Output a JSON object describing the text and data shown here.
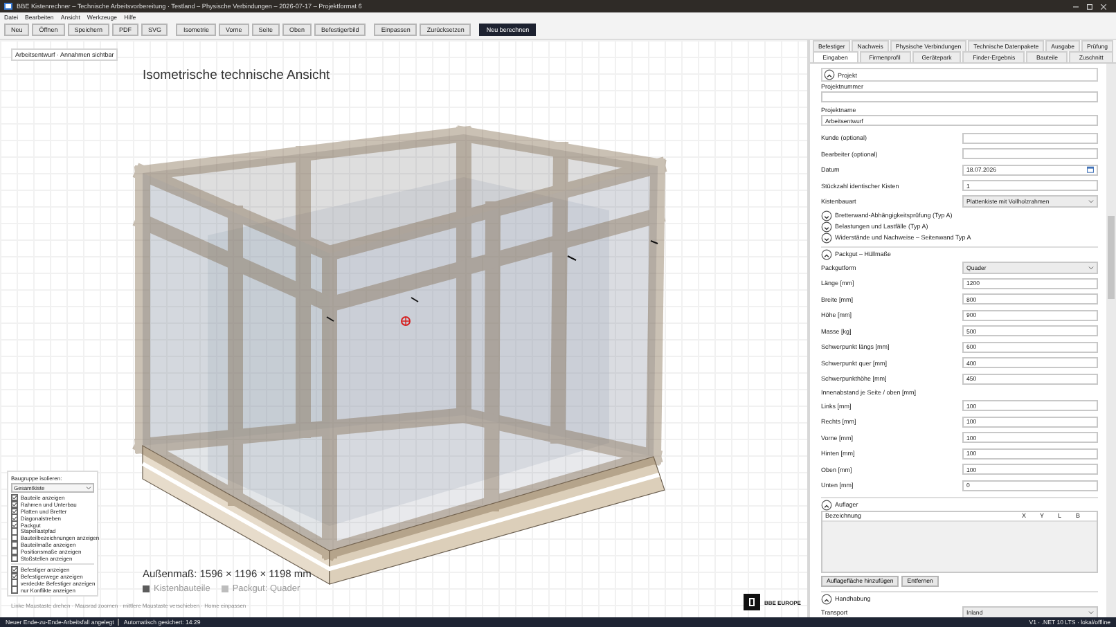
{
  "window": {
    "title": "BBE Kistenrechner – Technische Arbeitsvorbereitung · Testland – Physische Verbindungen – 2026-07-17 – Projektformat 6"
  },
  "menu": [
    "Datei",
    "Bearbeiten",
    "Ansicht",
    "Werkzeuge",
    "Hilfe"
  ],
  "toolbar": [
    {
      "buttons": [
        {
          "label": "Neu",
          "kind": "default"
        },
        {
          "label": "Öffnen",
          "kind": "default"
        },
        {
          "label": "Speichern",
          "kind": "default"
        },
        {
          "label": "PDF",
          "kind": "default"
        },
        {
          "label": "SVG",
          "kind": "default"
        }
      ]
    },
    {
      "buttons": [
        {
          "label": "Isometrie",
          "kind": "default"
        },
        {
          "label": "Vorne",
          "kind": "default"
        },
        {
          "label": "Seite",
          "kind": "default"
        },
        {
          "label": "Oben",
          "kind": "default"
        },
        {
          "label": "Befestigerbild",
          "kind": "default"
        }
      ]
    },
    {
      "buttons": [
        {
          "label": "Einpassen",
          "kind": "default"
        },
        {
          "label": "Zurücksetzen",
          "kind": "default"
        }
      ]
    },
    {
      "buttons": [
        {
          "label": "Neu berechnen",
          "kind": "primary"
        }
      ]
    }
  ],
  "viewport": {
    "badge": "Arbeitsentwurf · Annahmen sichtbar",
    "title": "Isometrische technische Ansicht",
    "dimensions": "Außenmaß: 1596 × 1196 × 1198 mm",
    "legend": [
      {
        "label": "Kistenbauteile",
        "color": "#5c5c5c"
      },
      {
        "label": "Packgut: Quader",
        "color": "#bdbdbd"
      }
    ],
    "hint": "Linke Maustaste drehen · Mausrad zoomen · mittlere Maustaste verschieben · Home einpassen",
    "logo": "BBE EUROPE"
  },
  "layers": {
    "label": "Baugruppe isolieren:",
    "select": "Gesamtkiste",
    "groups": [
      [
        {
          "label": "Bauteile anzeigen",
          "checked": true
        },
        {
          "label": "Rahmen und Unterbau",
          "checked": true
        },
        {
          "label": "Platten und Bretter",
          "checked": true
        },
        {
          "label": "Diagonalstreben",
          "checked": true
        },
        {
          "label": "Packgut",
          "checked": true
        },
        {
          "label": "Stapellastpfad",
          "checked": false
        },
        {
          "label": "Bauteilbezeichnungen anzeigen",
          "checked": false
        },
        {
          "label": "Bauteilmaße anzeigen",
          "checked": false
        },
        {
          "label": "Positionsmaße anzeigen",
          "checked": false
        },
        {
          "label": "Stoßstellen anzeigen",
          "checked": false
        }
      ],
      [
        {
          "label": "Befestiger anzeigen",
          "checked": true
        },
        {
          "label": "Befestigerwege anzeigen",
          "checked": true
        },
        {
          "label": "verdeckte Befestiger anzeigen",
          "checked": false
        },
        {
          "label": "nur Konflikte anzeigen",
          "checked": false
        }
      ]
    ]
  },
  "panel": {
    "tab_rows": [
      [
        {
          "label": "Befestiger",
          "selected": false
        },
        {
          "label": "Nachweis",
          "selected": false
        },
        {
          "label": "Physische Verbindungen",
          "selected": false
        },
        {
          "label": "Technische Datenpakete",
          "selected": false
        },
        {
          "label": "Ausgabe",
          "selected": false
        },
        {
          "label": "Prüfung",
          "selected": false
        }
      ],
      [
        {
          "label": "Eingaben",
          "selected": true
        },
        {
          "label": "Firmenprofil",
          "selected": false
        },
        {
          "label": "Gerätepark",
          "selected": false
        },
        {
          "label": "Finder-Ergebnis",
          "selected": false
        },
        {
          "label": "Bauteile",
          "selected": false
        },
        {
          "label": "Zuschnitt",
          "selected": false
        }
      ]
    ],
    "sections": [
      {
        "title": "Projekt",
        "expanded": true,
        "items": [
          {
            "kind": "stacked",
            "label": "Projektnummer"
          },
          {
            "kind": "stacked",
            "label": "Projektname",
            "value": "Arbeitsentwurf"
          },
          {
            "kind": "field",
            "label": "Kunde (optional)"
          },
          {
            "kind": "field",
            "label": "Bearbeiter (optional)"
          },
          {
            "kind": "date",
            "label": "Datum",
            "value": "18.07.2026"
          },
          {
            "kind": "field",
            "label": "Stückzahl identischer Kisten",
            "value": "1"
          },
          {
            "kind": "select",
            "label": "Kistenbauart",
            "value": "Plattenkiste mit Vollholzrahmen"
          }
        ]
      },
      {
        "title": "Bretterwand-Abhängigkeitsprüfung (Typ A)",
        "expanded": false
      },
      {
        "title": "Belastungen und Lastfälle (Typ A)",
        "expanded": false
      },
      {
        "title": "Widerstände und Nachweise – Seitenwand Typ A",
        "expanded": false
      },
      {
        "title": "Packgut – Hüllmaße",
        "expanded": true,
        "items": [
          {
            "kind": "select",
            "label": "Packgutform",
            "value": "Quader"
          },
          {
            "kind": "field",
            "label": "Länge [mm]",
            "value": "1200"
          },
          {
            "kind": "field",
            "label": "Breite [mm]",
            "value": "800"
          },
          {
            "kind": "field",
            "label": "Höhe [mm]",
            "value": "900"
          },
          {
            "kind": "field",
            "label": "Masse [kg]",
            "value": "500"
          },
          {
            "kind": "field",
            "label": "Schwerpunkt längs [mm]",
            "value": "600"
          },
          {
            "kind": "field",
            "label": "Schwerpunkt quer [mm]",
            "value": "400"
          },
          {
            "kind": "field",
            "label": "Schwerpunkthöhe [mm]",
            "value": "450"
          },
          {
            "kind": "note",
            "label": "Innenabstand je Seite / oben [mm]"
          },
          {
            "kind": "field",
            "label": "Links [mm]",
            "value": "100"
          },
          {
            "kind": "field",
            "label": "Rechts [mm]",
            "value": "100"
          },
          {
            "kind": "field",
            "label": "Vorne [mm]",
            "value": "100"
          },
          {
            "kind": "field",
            "label": "Hinten [mm]",
            "value": "100"
          },
          {
            "kind": "field",
            "label": "Oben [mm]",
            "value": "100"
          },
          {
            "kind": "field",
            "label": "Unten [mm]",
            "value": "0"
          }
        ]
      },
      {
        "title": "Auflager",
        "expanded": true,
        "items": [
          {
            "kind": "table",
            "columns": [
              "Bezeichnung",
              "X",
              "Y",
              "L",
              "B"
            ],
            "buttons": [
              "Auflagefläche hinzufügen",
              "Entfernen"
            ]
          }
        ]
      },
      {
        "title": "Handhabung",
        "expanded": true,
        "items": [
          {
            "kind": "select",
            "label": "Transport",
            "value": "Inland"
          }
        ]
      }
    ]
  },
  "status_bar": {
    "left": [
      "Neuer Ende-zu-Ende-Arbeitsfall angelegt",
      "Automatisch gesichert: 14:29"
    ],
    "right": "V1 · .NET 10 LTS · lokal/offline"
  }
}
